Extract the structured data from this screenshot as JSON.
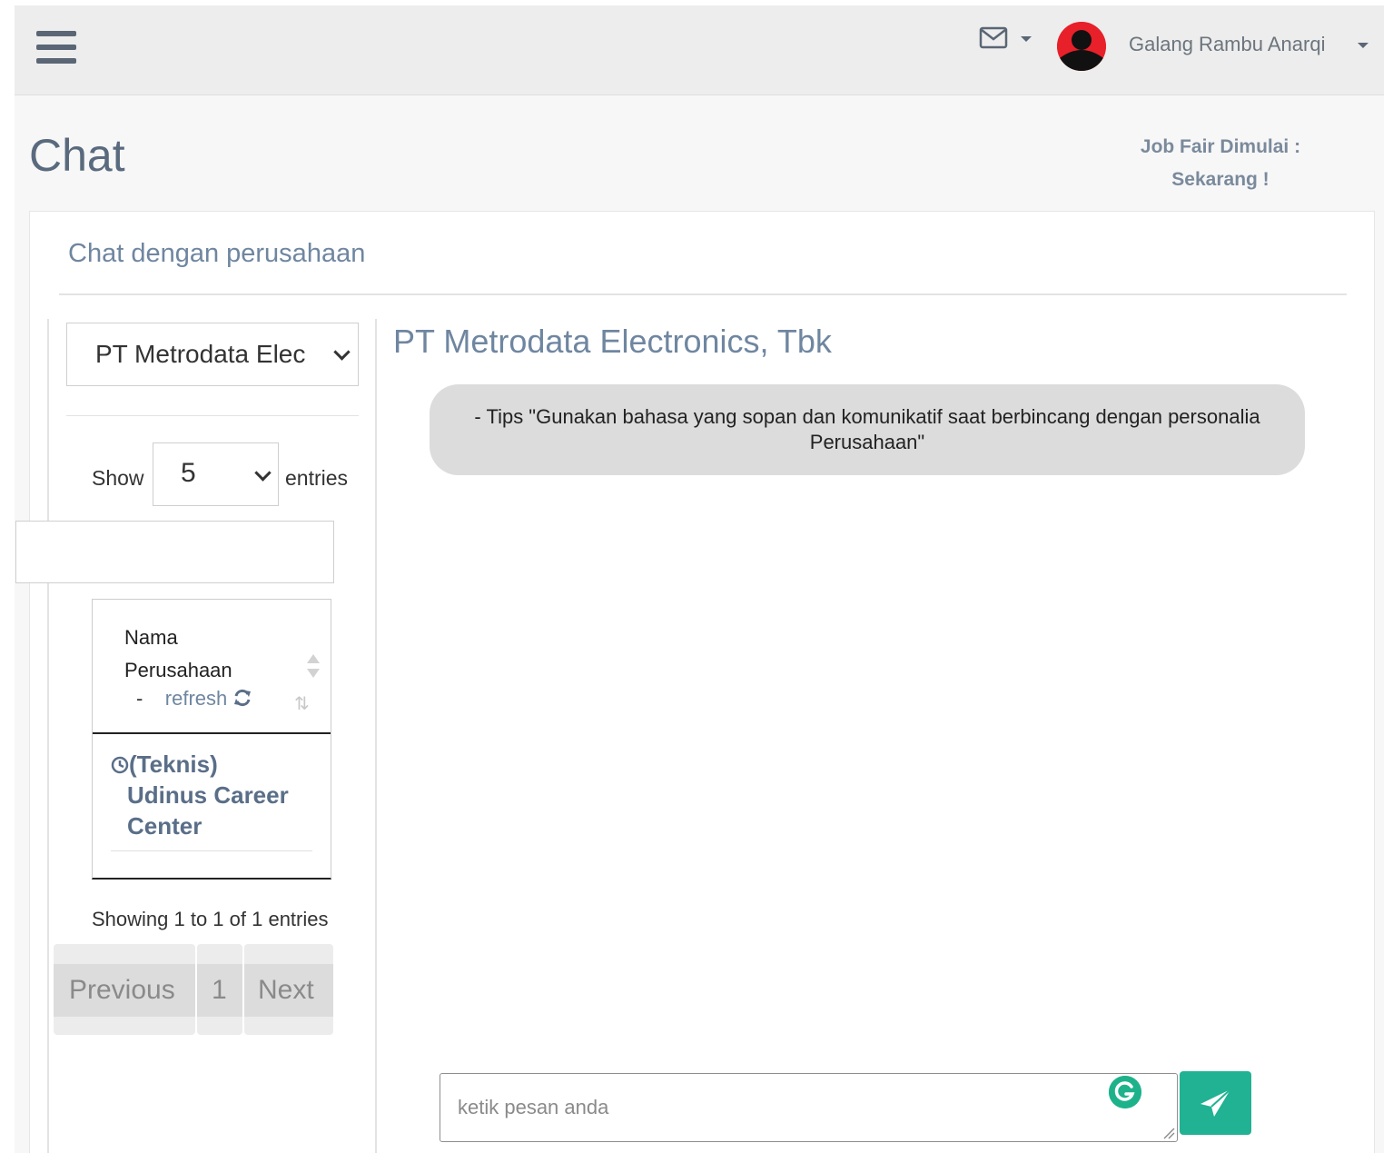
{
  "topbar": {
    "username": "Galang Rambu Anarqi"
  },
  "page": {
    "title": "Chat",
    "jobfair_line1": "Job Fair Dimulai :",
    "jobfair_line2": "Sekarang !"
  },
  "card": {
    "title": "Chat dengan perusahaan"
  },
  "sidebar": {
    "company_select_value": "PT Metrodata Elec",
    "show_label": "Show",
    "entries_value": "5",
    "entries_label": "entries",
    "table": {
      "header_line1": "Nama",
      "header_line2": "Perusahaan",
      "header_dash": "-",
      "refresh_label": "refresh",
      "rows": [
        {
          "prefix": "(Teknis)",
          "name": "Udinus Career Center"
        }
      ]
    },
    "showing_text": "Showing 1 to 1 of 1 entries",
    "pagination": {
      "previous": "Previous",
      "page": "1",
      "next": "Next"
    }
  },
  "chat": {
    "company_title": "PT Metrodata Electronics, Tbk",
    "tips_text": "- Tips \"Gunakan bahasa yang sopan dan komunikatif saat berbincang dengan personalia Perusahaan\"",
    "input_placeholder": "ketik pesan anda"
  },
  "colors": {
    "accent": "#20b293",
    "title_blue": "#6f86a0",
    "avatar_red": "#e8202a"
  }
}
